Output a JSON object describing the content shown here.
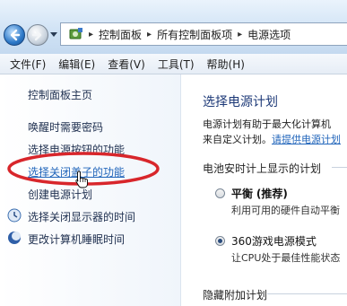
{
  "address": {
    "crumbs": [
      "控制面板",
      "所有控制面板项",
      "电源选项"
    ]
  },
  "menu": [
    "文件(F)",
    "编辑(E)",
    "查看(V)",
    "工具(T)",
    "帮助(H)"
  ],
  "sidebar": {
    "items": [
      {
        "label": "控制面板主页"
      },
      {
        "label": "唤醒时需要密码"
      },
      {
        "label": "选择电源按钮的功能"
      },
      {
        "label": "选择关闭盖子的功能"
      },
      {
        "label": "创建电源计划"
      },
      {
        "label": "选择关闭显示器的时间"
      },
      {
        "label": "更改计算机睡眠时间"
      }
    ]
  },
  "main": {
    "title": "选择电源计划",
    "desc_line1": "电源计划有助于最大化计算机",
    "desc_line2_prefix": "来自定义计划。",
    "desc_link": "请提供电源计划",
    "section_battery": "电池安时计上显示的计划",
    "plans": [
      {
        "name": "平衡",
        "suffix": "(推荐)",
        "desc": "利用可用的硬件自动平衡",
        "selected": false
      },
      {
        "name": "360游戏电源模式",
        "suffix": "",
        "desc": "让CPU处于最佳性能状态",
        "selected": true
      }
    ],
    "section_hidden": "隐藏附加计划"
  },
  "colors": {
    "annotation": "#d8262b",
    "link": "#2266bb",
    "title": "#1e3a78"
  }
}
